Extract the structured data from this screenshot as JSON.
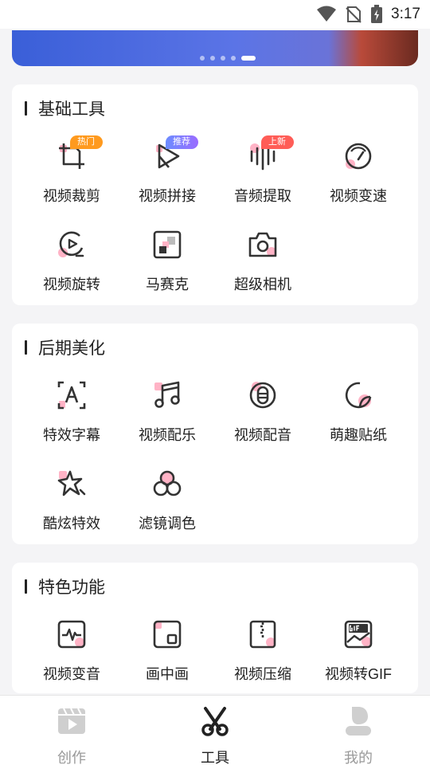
{
  "status_bar": {
    "time": "3:17"
  },
  "sections": [
    {
      "title": "基础工具",
      "tools": [
        {
          "label": "视频裁剪",
          "icon": "crop-icon",
          "tag": "热门"
        },
        {
          "label": "视频拼接",
          "icon": "play-triangle-icon",
          "tag": "推荐"
        },
        {
          "label": "音频提取",
          "icon": "waveform-icon",
          "tag": "上新"
        },
        {
          "label": "视频变速",
          "icon": "speedometer-icon"
        },
        {
          "label": "视频旋转",
          "icon": "rotate-icon"
        },
        {
          "label": "马赛克",
          "icon": "mosaic-icon"
        },
        {
          "label": "超级相机",
          "icon": "camera-icon"
        }
      ]
    },
    {
      "title": "后期美化",
      "tools": [
        {
          "label": "特效字幕",
          "icon": "text-a-icon"
        },
        {
          "label": "视频配乐",
          "icon": "music-note-icon"
        },
        {
          "label": "视频配音",
          "icon": "microphone-icon"
        },
        {
          "label": "萌趣贴纸",
          "icon": "sticker-icon"
        },
        {
          "label": "酷炫特效",
          "icon": "star-sparkle-icon"
        },
        {
          "label": "滤镜调色",
          "icon": "filter-circles-icon"
        }
      ]
    },
    {
      "title": "特色功能",
      "tools": [
        {
          "label": "视频变音",
          "icon": "voice-wave-icon"
        },
        {
          "label": "画中画",
          "icon": "picture-in-picture-icon"
        },
        {
          "label": "视频压缩",
          "icon": "zip-icon"
        },
        {
          "label": "视频转GIF",
          "icon": "gif-icon"
        }
      ]
    }
  ],
  "bottom_nav": [
    {
      "label": "创作",
      "icon": "clapperboard-icon",
      "active": false
    },
    {
      "label": "工具",
      "icon": "scissors-icon",
      "active": true
    },
    {
      "label": "我的",
      "icon": "user-icon",
      "active": false
    }
  ],
  "colors": {
    "accent_pink": "#ffb3c6",
    "text": "#222222",
    "inactive": "#9a9a9a"
  }
}
